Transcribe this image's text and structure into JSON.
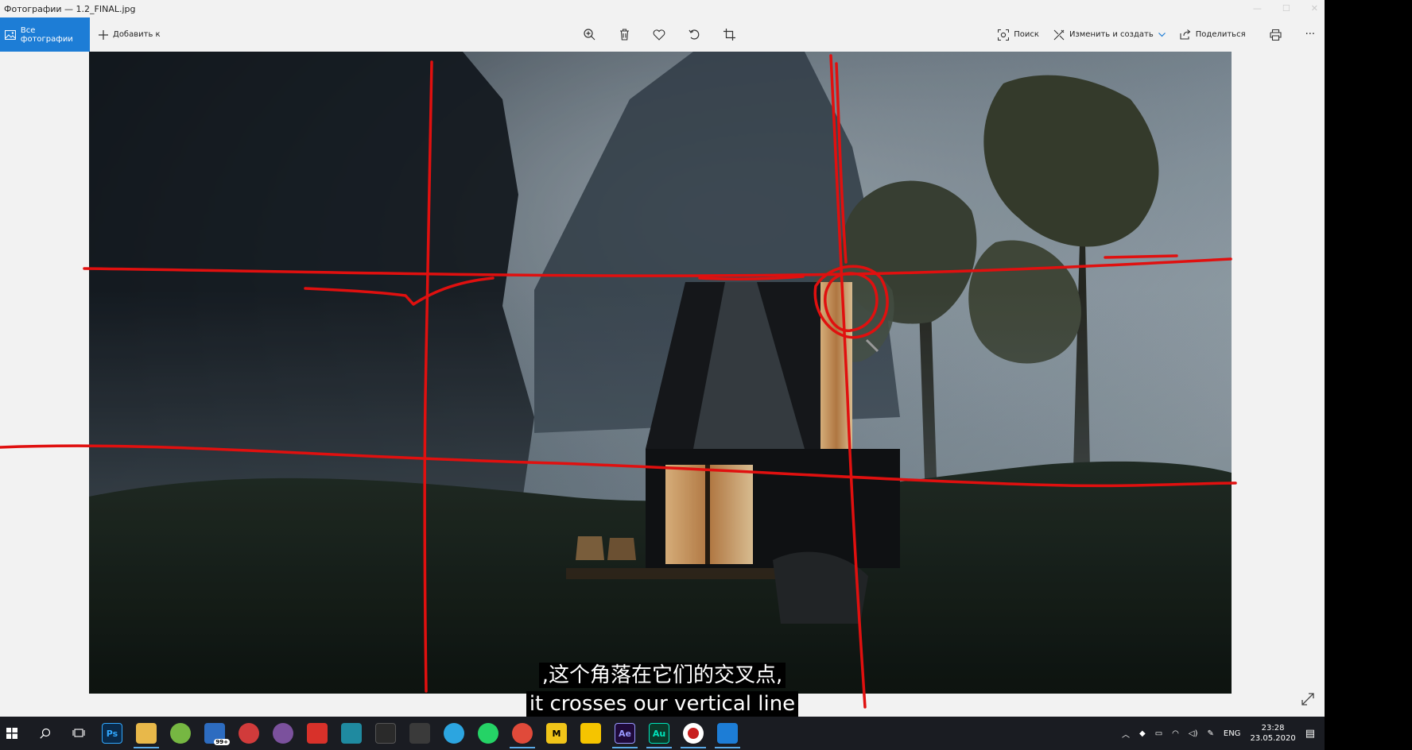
{
  "window": {
    "title": "Фотографии — 1.2_FINAL.jpg",
    "min": "—",
    "max": "☐",
    "close": "✕"
  },
  "toolbar": {
    "all_photos_label": "Все фотографии",
    "add_to_label": "Добавить к",
    "search_label": "Поиск",
    "edit_create_label": "Изменить и создать",
    "share_label": "Поделиться",
    "more_label": "···"
  },
  "subtitles": {
    "zh": ",这个角落在它们的交叉点,",
    "en": "it crosses our vertical line"
  },
  "taskbar": {
    "apps": [
      {
        "name": "photoshop",
        "label": "Ps",
        "color": "#0a2a4a"
      },
      {
        "name": "file-explorer",
        "label": "",
        "color": "#e8b84a"
      },
      {
        "name": "utorrent",
        "label": "",
        "color": "#76b742"
      },
      {
        "name": "mail",
        "label": "99+",
        "color": "#2d6cc0"
      },
      {
        "name": "anydesk",
        "label": "",
        "color": "#d13b3b"
      },
      {
        "name": "viber",
        "label": "",
        "color": "#7b519d"
      },
      {
        "name": "acrobat",
        "label": "",
        "color": "#d8312a"
      },
      {
        "name": "marker-app",
        "label": "",
        "color": "#1f8aa0"
      },
      {
        "name": "predator-app",
        "label": "",
        "color": "#2a2a2a"
      },
      {
        "name": "sketchup",
        "label": "",
        "color": "#3a3a3a"
      },
      {
        "name": "telegram",
        "label": "",
        "color": "#2ca5e0"
      },
      {
        "name": "whatsapp",
        "label": "",
        "color": "#25d366"
      },
      {
        "name": "chrome",
        "label": "",
        "color": "#e04a3a"
      },
      {
        "name": "miro",
        "label": "M",
        "color": "#f0c419"
      },
      {
        "name": "folder-yellow",
        "label": "",
        "color": "#f5c400"
      },
      {
        "name": "after-effects",
        "label": "Ae",
        "color": "#1f0a3a"
      },
      {
        "name": "audition",
        "label": "Au",
        "color": "#0a3a2a"
      },
      {
        "name": "recorder",
        "label": "",
        "color": "#c81e1e"
      },
      {
        "name": "photos-app",
        "label": "",
        "color": "#1d7dd6"
      }
    ],
    "lang": "ENG",
    "time": "23:28",
    "date": "23.05.2020"
  }
}
